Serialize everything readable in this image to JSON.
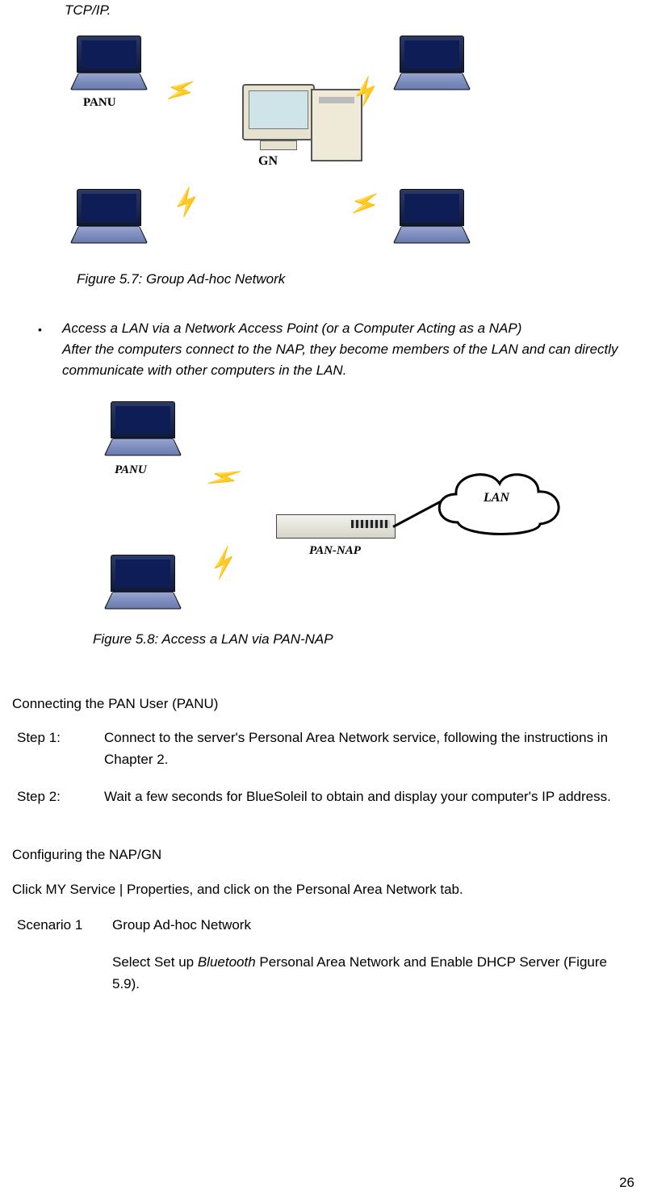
{
  "topFragment": "TCP/IP.",
  "diagram1": {
    "panuLabel": "PANU",
    "gnLabel": "GN"
  },
  "figCaption1": "Figure 5.7: Group Ad-hoc Network",
  "bullet2": {
    "title": "Access a LAN via a Network Access Point (or a Computer Acting as a NAP)",
    "body": "After the computers connect to the NAP, they become members of the LAN and can directly communicate with other computers in the LAN."
  },
  "diagram2": {
    "panuLabel": "PANU",
    "napLabel": "PAN-NAP",
    "lanLabel": "LAN"
  },
  "figCaption2": "Figure 5.8: Access a LAN via PAN-NAP",
  "section1": "Connecting the PAN User (PANU)",
  "steps": [
    {
      "label": "Step 1:",
      "body": "Connect to the server's Personal Area Network service, following the instructions in Chapter 2."
    },
    {
      "label": "Step 2:",
      "body": "Wait a few seconds for BlueSoleil to obtain and display your computer's IP address."
    }
  ],
  "section2": "Configuring the NAP/GN",
  "clickLine": "Click MY Service | Properties, and click on the Personal Area Network tab.",
  "scenario": {
    "label": "Scenario 1",
    "title": "Group Ad-hoc Network",
    "bodyPre": "Select Set up ",
    "bodyItalic": "Bluetooth",
    "bodyPost": " Personal Area Network and Enable DHCP Server (Figure 5.9)."
  },
  "pageNum": "26"
}
